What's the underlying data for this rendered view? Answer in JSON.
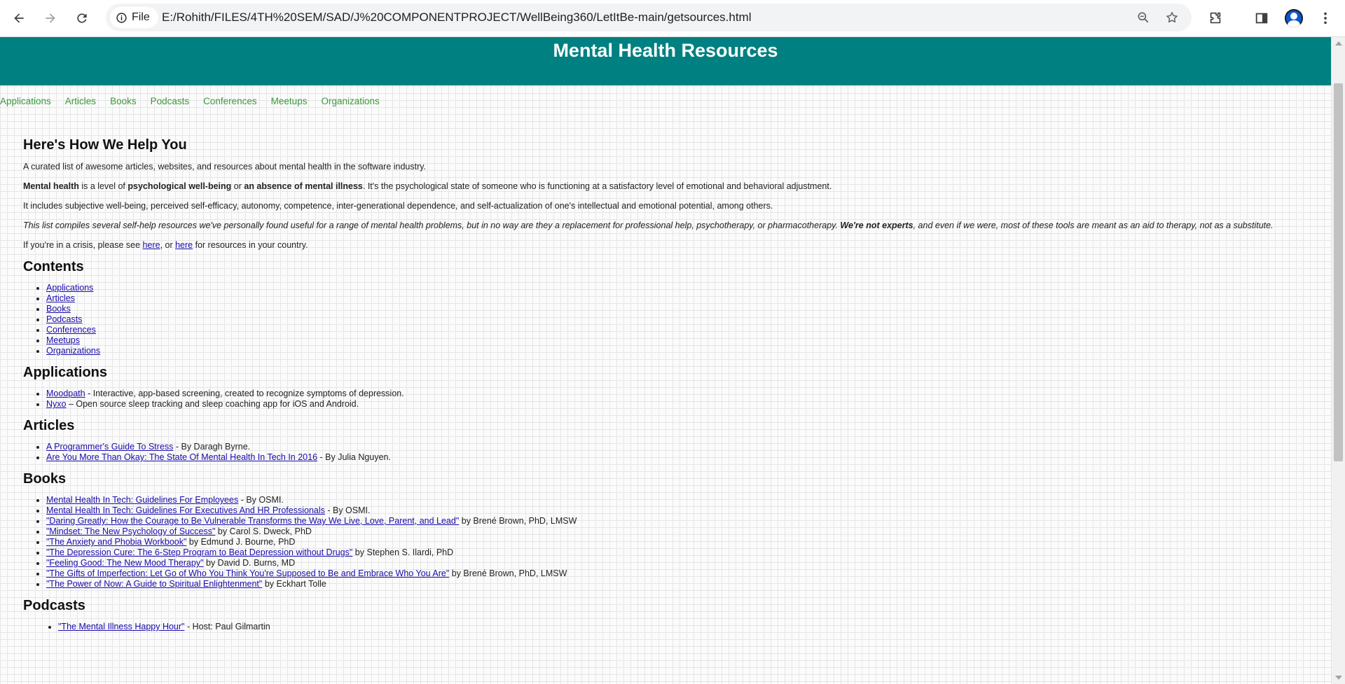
{
  "browser": {
    "file_label": "File",
    "url": "E:/Rohith/FILES/4TH%20SEM/SAD/J%20COMPONENTPROJECT/WellBeing360/LetItBe-main/getsources.html"
  },
  "header": {
    "title": "Mental Health Resources"
  },
  "nav": [
    "Applications",
    "Articles",
    "Books",
    "Podcasts",
    "Conferences",
    "Meetups",
    "Organizations"
  ],
  "intro": {
    "heading": "Here's How We Help You",
    "p1": "A curated list of awesome articles, websites, and resources about mental health in the software industry.",
    "p2": {
      "b1": "Mental health",
      "t1": " is a level of ",
      "b2": "psychological well-being",
      "t2": " or ",
      "b3": "an absence of mental illness",
      "t3": ". It's the psychological state of someone who is functioning at a satisfactory level of emotional and behavioral adjustment."
    },
    "p3": "It includes subjective well-being, perceived self-efficacy, autonomy, competence, inter-generational dependence, and self-actualization of one's intellectual and emotional potential, among others.",
    "p4": {
      "t1": "This list compiles several self-help resources we've personally found useful for a range of mental health problems, but in no way are they a replacement for professional help, psychotherapy, or pharmacotherapy. ",
      "b1": "We're not experts",
      "t2": ", and even if we were, most of these tools are meant as an aid to therapy, not as a substitute."
    },
    "p5": {
      "t1": "If you're in a crisis, please see ",
      "link1": "here",
      "t2": ", or ",
      "link2": "here",
      "t3": " for resources in your country."
    }
  },
  "contents": {
    "heading": "Contents",
    "items": [
      "Applications",
      "Articles",
      "Books",
      "Podcasts",
      "Conferences",
      "Meetups",
      "Organizations"
    ]
  },
  "applications": {
    "heading": "Applications",
    "items": [
      {
        "link": "Moodpath",
        "text": " - Interactive, app-based screening, created to recognize symptoms of depression."
      },
      {
        "link": "Nyxo",
        "text": " – Open source sleep tracking and sleep coaching app for iOS and Android."
      }
    ]
  },
  "articles": {
    "heading": "Articles",
    "items": [
      {
        "link": "A Programmer's Guide To Stress",
        "text": " - By Daragh Byrne."
      },
      {
        "link": "Are You More Than Okay: The State Of Mental Health In Tech In 2016",
        "text": " - By Julia Nguyen."
      }
    ]
  },
  "books": {
    "heading": "Books",
    "items": [
      {
        "link": "Mental Health In Tech: Guidelines For Employees",
        "text": " - By OSMI."
      },
      {
        "link": "Mental Health In Tech: Guidelines For Executives And HR Professionals",
        "text": " - By OSMI."
      },
      {
        "link": "\"Daring Greatly: How the Courage to Be Vulnerable Transforms the Way We Live, Love, Parent, and Lead\"",
        "text": " by Brené Brown, PhD, LMSW"
      },
      {
        "link": "\"Mindset: The New Psychology of Success\"",
        "text": " by Carol S. Dweck, PhD"
      },
      {
        "link": "\"The Anxiety and Phobia Workbook\"",
        "text": " by Edmund J. Bourne, PhD"
      },
      {
        "link": "\"The Depression Cure: The 6-Step Program to Beat Depression without Drugs\"",
        "text": " by Stephen S. Ilardi, PhD"
      },
      {
        "link": "\"Feeling Good: The New Mood Therapy\"",
        "text": " by David D. Burns, MD"
      },
      {
        "link": "\"The Gifts of Imperfection: Let Go of Who You Think You're Supposed to Be and Embrace Who You Are\"",
        "text": " by Brené Brown, PhD, LMSW"
      },
      {
        "link": "\"The Power of Now: A Guide to Spiritual Enlightenment\"",
        "text": " by Eckhart Tolle"
      }
    ]
  },
  "podcasts": {
    "heading": "Podcasts",
    "items": [
      {
        "link": "\"The Mental Illness Happy Hour\"",
        "text": " - Host: Paul Gilmartin"
      }
    ]
  },
  "colors": {
    "header_bg": "#008080",
    "nav_link": "#3a9a3a",
    "link": "#1a0dab"
  }
}
